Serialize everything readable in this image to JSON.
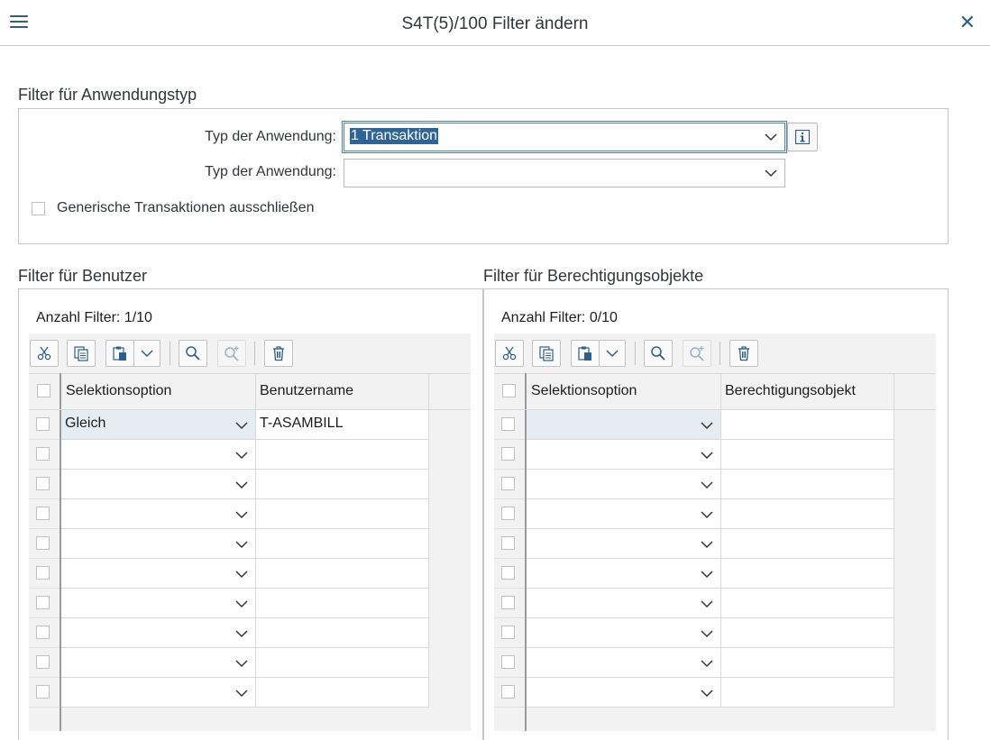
{
  "window": {
    "title": "S4T(5)/100 Filter ändern",
    "close_symbol": "✕"
  },
  "app_type_section": {
    "title": "Filter für Anwendungstyp",
    "field1_label": "Typ der Anwendung:",
    "field1_value": "1 Transaktion",
    "field2_label": "Typ der Anwendung:",
    "field2_value": "",
    "exclude_checkbox_label": "Generische Transaktionen ausschließen",
    "exclude_checked": false
  },
  "user_filter": {
    "title": "Filter für Benutzer",
    "counter": "Anzahl Filter: 1/10",
    "columns": [
      "Selektionsoption",
      "Benutzername"
    ],
    "rows": [
      {
        "option": "Gleich",
        "value": "T-ASAMBILL"
      },
      {
        "option": "",
        "value": ""
      },
      {
        "option": "",
        "value": ""
      },
      {
        "option": "",
        "value": ""
      },
      {
        "option": "",
        "value": ""
      },
      {
        "option": "",
        "value": ""
      },
      {
        "option": "",
        "value": ""
      },
      {
        "option": "",
        "value": ""
      },
      {
        "option": "",
        "value": ""
      },
      {
        "option": "",
        "value": ""
      }
    ]
  },
  "auth_filter": {
    "title": "Filter für Berechtigungsobjekte",
    "counter": "Anzahl Filter: 0/10",
    "columns": [
      "Selektionsoption",
      "Berechtigungsobjekt"
    ],
    "rows": [
      {
        "option": "",
        "value": ""
      },
      {
        "option": "",
        "value": ""
      },
      {
        "option": "",
        "value": ""
      },
      {
        "option": "",
        "value": ""
      },
      {
        "option": "",
        "value": ""
      },
      {
        "option": "",
        "value": ""
      },
      {
        "option": "",
        "value": ""
      },
      {
        "option": "",
        "value": ""
      },
      {
        "option": "",
        "value": ""
      },
      {
        "option": "",
        "value": ""
      }
    ]
  },
  "toolbar_icons": [
    "cut-icon",
    "copy-icon",
    "paste-icon",
    "chevron-down-icon",
    "search-icon",
    "search-next-icon",
    "delete-icon"
  ],
  "colors": {
    "accent": "#2c5f8f",
    "selection": "#2f6496",
    "selected_row": "#e5ecf4",
    "panel_bg": "#f2f2f2"
  }
}
